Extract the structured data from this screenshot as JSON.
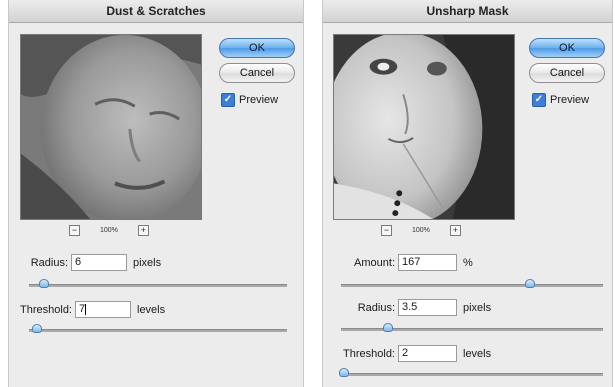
{
  "dust_scratches": {
    "title": "Dust & Scratches",
    "ok_label": "OK",
    "cancel_label": "Cancel",
    "preview_label": "Preview",
    "preview_checked": true,
    "zoom_minus": "−",
    "zoom_level": "100%",
    "zoom_plus": "+",
    "radius": {
      "label": "Radius:",
      "value": "6",
      "unit": "pixels",
      "slider_fraction": 0.06
    },
    "threshold": {
      "label": "Threshold:",
      "value": "7",
      "unit": "levels",
      "slider_fraction": 0.03
    }
  },
  "unsharp_mask": {
    "title": "Unsharp Mask",
    "ok_label": "OK",
    "cancel_label": "Cancel",
    "preview_label": "Preview",
    "preview_checked": true,
    "zoom_minus": "−",
    "zoom_level": "100%",
    "zoom_plus": "+",
    "amount": {
      "label": "Amount:",
      "value": "167",
      "unit": "%",
      "slider_fraction": 0.72
    },
    "radius": {
      "label": "Radius:",
      "value": "3.5",
      "unit": "pixels",
      "slider_fraction": 0.18
    },
    "threshold": {
      "label": "Threshold:",
      "value": "2",
      "unit": "levels",
      "slider_fraction": 0.01
    }
  },
  "colors": {
    "dialog_bg": "#ececec",
    "ok_button": "#6fb3ef",
    "checkbox": "#3b7fd6",
    "slider_thumb": "#7fb7ea"
  }
}
